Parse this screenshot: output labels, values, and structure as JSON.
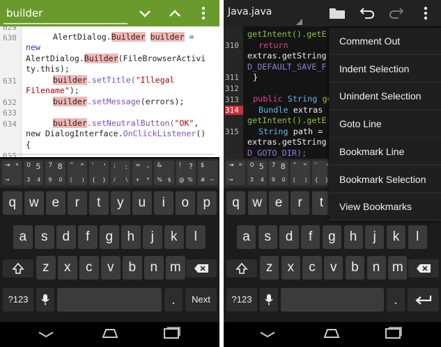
{
  "left": {
    "find": {
      "query": "builder"
    },
    "lines": {
      "l629": "629",
      "l630": "630",
      "l631": "631",
      "l632": "632",
      "l633": "633",
      "l634": "634",
      "l635": "635",
      "c1_pre": "AlertDialog.",
      "c1_hl": "Builder",
      "c1_sp": " ",
      "c1_hl2": "builder",
      "c1_post": " =",
      "c2": "new",
      "c3_pre": "AlertDialog.",
      "c3_hl": "Builder",
      "c3_post": "(FileBrowserActivi",
      "c4": "ty.this);",
      "c5_hl": "builder",
      "c5_fn": ".setTitle(",
      "c5_str": "\"Illegal",
      "c6_str": "Filename\"",
      "c6_post": ");",
      "c7_hl": "builder",
      "c7_fn": ".setMessage",
      "c7_post": "(errors);",
      "c8_hl": "builder",
      "c8_fn": ".setNeutralButton(",
      "c8_str": "\"OK\"",
      "c8_post": ",",
      "c9": "new DialogInterface.",
      "c9_fn": "OnClickListener",
      "c9_post": "()",
      "c10": "{"
    }
  },
  "keyboard": {
    "sym_keys": [
      {
        "tl": "⇥",
        "tr": "°",
        "bl": "→",
        "br": ""
      },
      {
        "tl": "0",
        "tr": "5",
        "bl": "3",
        "br": "4"
      },
      {
        "tl": "7",
        "tr": "8",
        "bl": "9",
        "br": "0"
      },
      {
        "tl": "“",
        "tr": "”",
        "bl": "(",
        "br": ")"
      },
      {
        "tl": "'",
        "tr": "‘",
        "bl": "{",
        "br": "}"
      },
      {
        "tl": ";",
        "tr": ":",
        "bl": "/",
        "br": "\\"
      },
      {
        "tl": "=",
        "tr": "-",
        "bl": "+",
        "br": "*"
      },
      {
        "tl": "&",
        "tr": "",
        "bl": "%",
        "br": "$"
      },
      {
        "tl": "!",
        "tr": "?",
        "bl": "@",
        "br": "%"
      },
      {
        "tl": "$",
        "tr": "",
        "bl": "#",
        "br": "~"
      }
    ],
    "row1": [
      "q",
      "w",
      "e",
      "r",
      "t",
      "y",
      "u",
      "i",
      "o",
      "p"
    ],
    "row2": [
      "a",
      "s",
      "d",
      "f",
      "g",
      "h",
      "j",
      "k",
      "l"
    ],
    "row3": [
      "z",
      "x",
      "c",
      "v",
      "b",
      "n",
      "m"
    ],
    "symbols_label": "?123",
    "period": ".",
    "next_label": "Next"
  },
  "right": {
    "tab_title": "Java.java",
    "lines": {
      "n310": "310",
      "n311": "311",
      "n312": "312",
      "n313": "313",
      "n314": "314",
      "n315": "315",
      "d1_fn": "getIntent().getE",
      "d2_kw": "return",
      "d3": "extras.getString",
      "d4_cn": "D_DEFAULT_SAVE_F",
      "d5": "}",
      "d6_kw": "public",
      "d6_ty": " String ",
      "d6_fn": "ge",
      "d7_ty": "Bundle",
      "d7_post": " extras",
      "d8_fn": "getIntent().getE",
      "d9_ty": "String",
      "d9_post": " path =",
      "d10": "extras.getString",
      "d11_cn": "D_GOTO_DIR);"
    },
    "menu": [
      "Comment Out",
      "Indent Selection",
      "Unindent Selection",
      "Goto Line",
      "Bookmark Line",
      "Bookmark Selection",
      "View Bookmarks"
    ]
  },
  "colors": {
    "accent_green": "#6a9a2c",
    "highlight": "#f3b6b6",
    "error_line": "#d0303a"
  },
  "icons": [
    "chevron-down-icon",
    "chevron-up-icon",
    "overflow-menu-icon",
    "folder-icon",
    "undo-icon",
    "redo-icon",
    "shift-icon",
    "backspace-icon",
    "mic-icon",
    "enter-icon",
    "back-icon",
    "home-icon",
    "recents-icon"
  ]
}
